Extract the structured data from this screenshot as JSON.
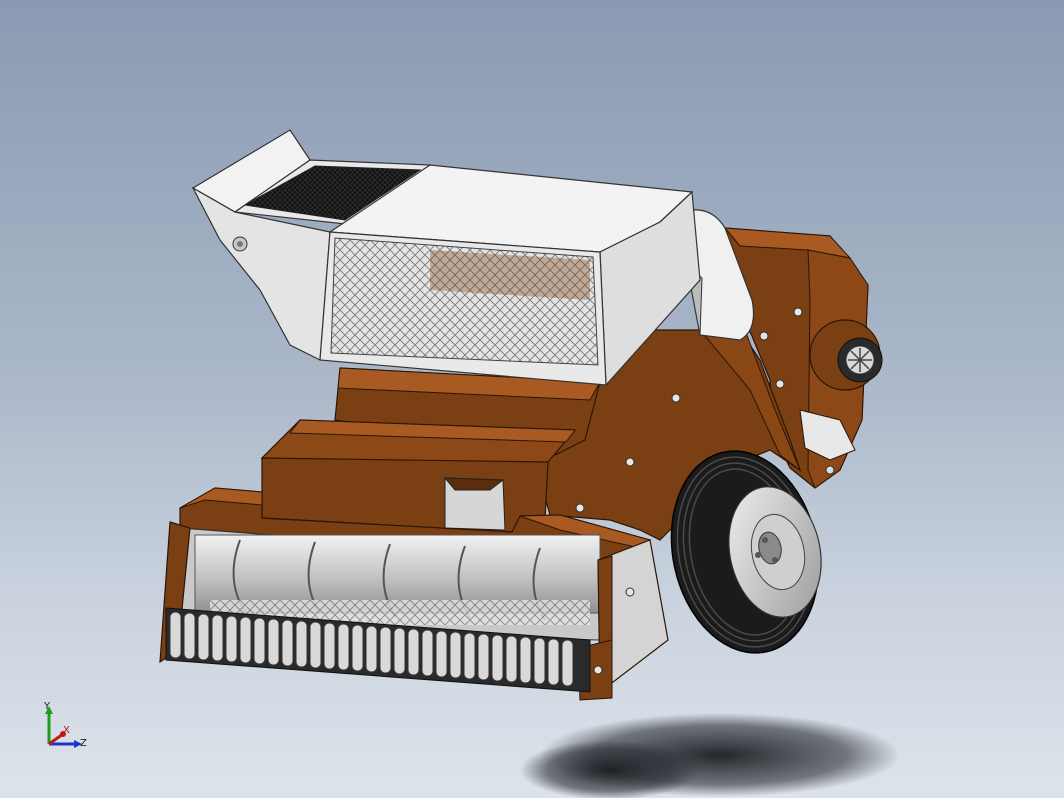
{
  "viewport": {
    "background_top": "#8a9ab2",
    "background_bottom": "#dde3ea"
  },
  "model": {
    "body_color": "#7a3f12",
    "body_highlight": "#a85a22",
    "steel_color": "#e6e6e6",
    "mesh_color": "#9a9a9a",
    "tire_color": "#1b1b1b"
  },
  "triad": {
    "x_label": "X",
    "y_label": "Y",
    "z_label": "Z",
    "x_color": "#c01818",
    "y_color": "#18a018",
    "z_color": "#1838c8"
  }
}
